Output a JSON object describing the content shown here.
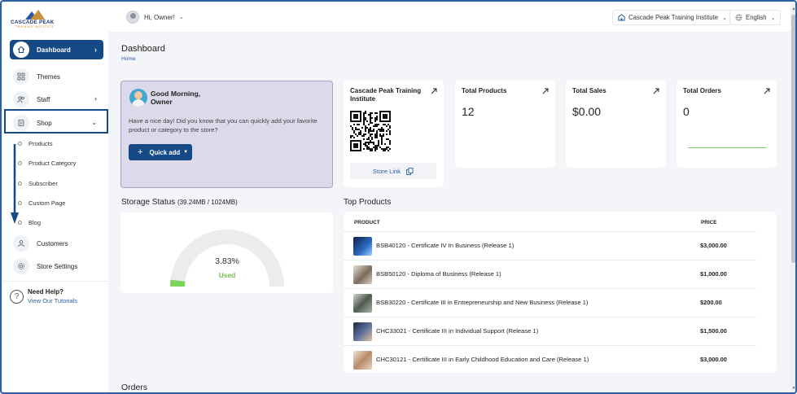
{
  "brand": {
    "name": "CASCADE PEAK",
    "tagline": "TRAINING INSTITUTE"
  },
  "sidebar": {
    "items": [
      {
        "label": "Dashboard",
        "icon": "home-icon",
        "active": true
      },
      {
        "label": "Themes",
        "icon": "themes-icon"
      },
      {
        "label": "Staff",
        "icon": "staff-icon"
      },
      {
        "label": "Shop",
        "icon": "shop-icon",
        "expanded": true
      },
      {
        "label": "Customers",
        "icon": "customers-icon"
      },
      {
        "label": "Store Settings",
        "icon": "settings-icon"
      }
    ],
    "shop_subitems": [
      "Products",
      "Product Category",
      "Subscriber",
      "Custom Page",
      "Blog"
    ],
    "help": {
      "title": "Need Help?",
      "link": "View Our Tutorials"
    }
  },
  "topbar": {
    "greeting": "Hi, Owner!",
    "institute": "Cascade Peak Training Institute",
    "language": "English"
  },
  "page": {
    "title": "Dashboard",
    "breadcrumb": "Home"
  },
  "welcome": {
    "greeting_line1": "Good Morning,",
    "greeting_line2": "Owner",
    "message": "Have a nice day! Did you know that you can quickly add your favorite product or category to the store?",
    "quick_add": "Quick add"
  },
  "store_card": {
    "title": "Cascade Peak Training Institute",
    "link": "Store Link"
  },
  "stats": [
    {
      "label": "Total Products",
      "value": "12"
    },
    {
      "label": "Total Sales",
      "value": "$0.00"
    },
    {
      "label": "Total Orders",
      "value": "0"
    }
  ],
  "storage": {
    "title": "Storage Status",
    "detail": "(39.24MB / 1024MB)",
    "percent_text": "3.83%",
    "percent": 3.83,
    "used_label": "Used"
  },
  "top_products": {
    "title": "Top Products",
    "columns": [
      "PRODUCT",
      "PRICE"
    ],
    "rows": [
      {
        "name": "BSB40120 - Certificate IV In Business (Release 1)",
        "price": "$3,000.00"
      },
      {
        "name": "BSB50120 - Diploma of Business (Release 1)",
        "price": "$1,000.00"
      },
      {
        "name": "BSB30220 - Certificate III in Entrepreneurship and New Business (Release 1)",
        "price": "$200.00"
      },
      {
        "name": "CHC33021 - Certificate III in Individual Support (Release 1)",
        "price": "$1,500.00"
      },
      {
        "name": "CHC30121 - Certificate III in Early Childhood Education and Care (Release 1)",
        "price": "$3,000.00"
      }
    ]
  },
  "orders": {
    "title": "Orders"
  },
  "colors": {
    "primary": "#164a86",
    "welcome_bg": "#dcd9ea",
    "used": "#6fbf4a",
    "chart_line": "#6fd15a"
  }
}
